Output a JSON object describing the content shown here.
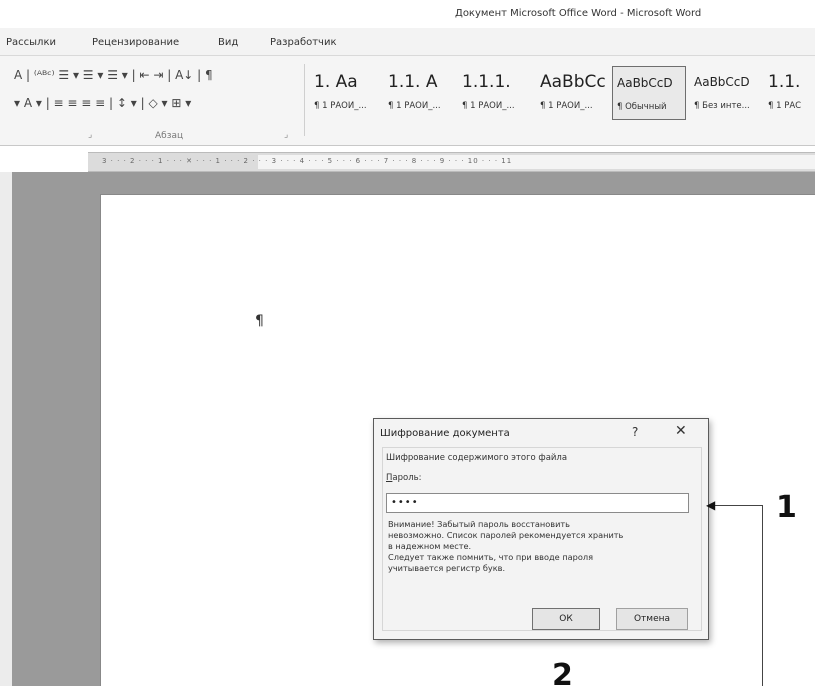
{
  "window": {
    "title": "Документ Microsoft Office Word - Microsoft Word"
  },
  "menu": {
    "tabs": [
      "Рассылки",
      "Рецензирование",
      "Вид",
      "Разработчик"
    ]
  },
  "ribbon": {
    "row1": "A | ⁽ᴬᴮᶜ⁾ ☰ ▾ ☰ ▾ ☰ ▾ | ⇤ ⇥ | A↓ | ¶",
    "row2": "▾ A ▾ | ≡ ≡ ≡ ≡ | ↕ ▾ | ◇ ▾ ⊞ ▾",
    "paragraph_group_label": "Абзац",
    "styles": [
      {
        "sample": "1. Aa",
        "name": "¶ 1 РАОИ_..."
      },
      {
        "sample": "1.1. A",
        "name": "¶ 1 РАОИ_..."
      },
      {
        "sample": "1.1.1.",
        "name": "¶ 1 РАОИ_..."
      },
      {
        "sample": "AaBbCc",
        "name": "¶ 1 РАОИ_..."
      },
      {
        "sample": "AaBbCcD",
        "name": "¶ Обычный"
      },
      {
        "sample": "AaBbCcD",
        "name": "¶ Без инте..."
      },
      {
        "sample": "1.1.",
        "name": "¶ 1 РАС"
      }
    ],
    "active_style_index": 4
  },
  "ruler": {
    "text": "3 · · · 2 · · · 1 · · · ✕ · · · 1 · · · 2 · · · 3 · · · 4 · · · 5 · · · 6 · · · 7 · · · 8 · · · 9 · · · 10 · · · 11"
  },
  "document": {
    "pilcrow": "¶"
  },
  "dialog": {
    "title": "Шифрование документа",
    "help": "?",
    "close": "✕",
    "subtitle": "Шифрование содержимого этого файла",
    "password_label": "Пароль:",
    "password_value": "••••",
    "warning_lines": [
      "Внимание! Забытый пароль восстановить",
      "невозможно. Список паролей рекомендуется хранить",
      "в надежном месте.",
      "Следует также помнить, что при вводе пароля",
      "учитывается регистр букв."
    ],
    "ok": "ОК",
    "cancel": "Отмена"
  },
  "callouts": {
    "one": "1",
    "two": "2"
  }
}
